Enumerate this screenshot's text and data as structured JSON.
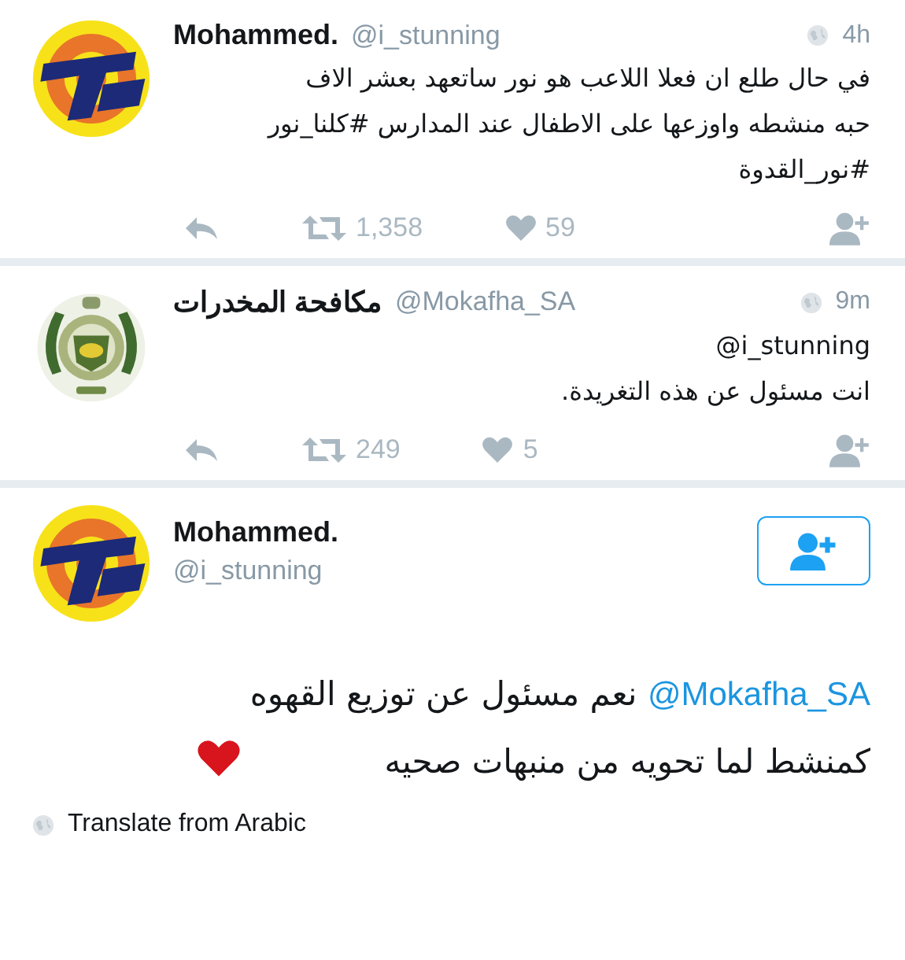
{
  "tweets": [
    {
      "name": "Mohammed.",
      "handle": "@i_stunning",
      "time": "4h",
      "text": "في حال طلع ان فعلا اللاعب هو نور ساتعهد بعشر الاف\nحبه منشطه واوزعها على الاطفال عند المدارس #كلنا_نور\n#نور_القدوة",
      "retweets": "1,358",
      "likes": "59"
    },
    {
      "name": "مكافحة المخدرات",
      "handle": "@Mokafha_SA",
      "time": "9m",
      "text": "@i_stunning\nانت مسئول عن هذه التغريدة.",
      "retweets": "249",
      "likes": "5"
    }
  ],
  "detail": {
    "name": "Mohammed.",
    "handle": "@i_stunning",
    "mention": "@Mokafha_SA",
    "text": "نعم مسئول عن توزيع القهوه\nكمنشط لما تحويه من منبهات صحيه",
    "heart": true,
    "translate": "Translate from Arabic"
  }
}
